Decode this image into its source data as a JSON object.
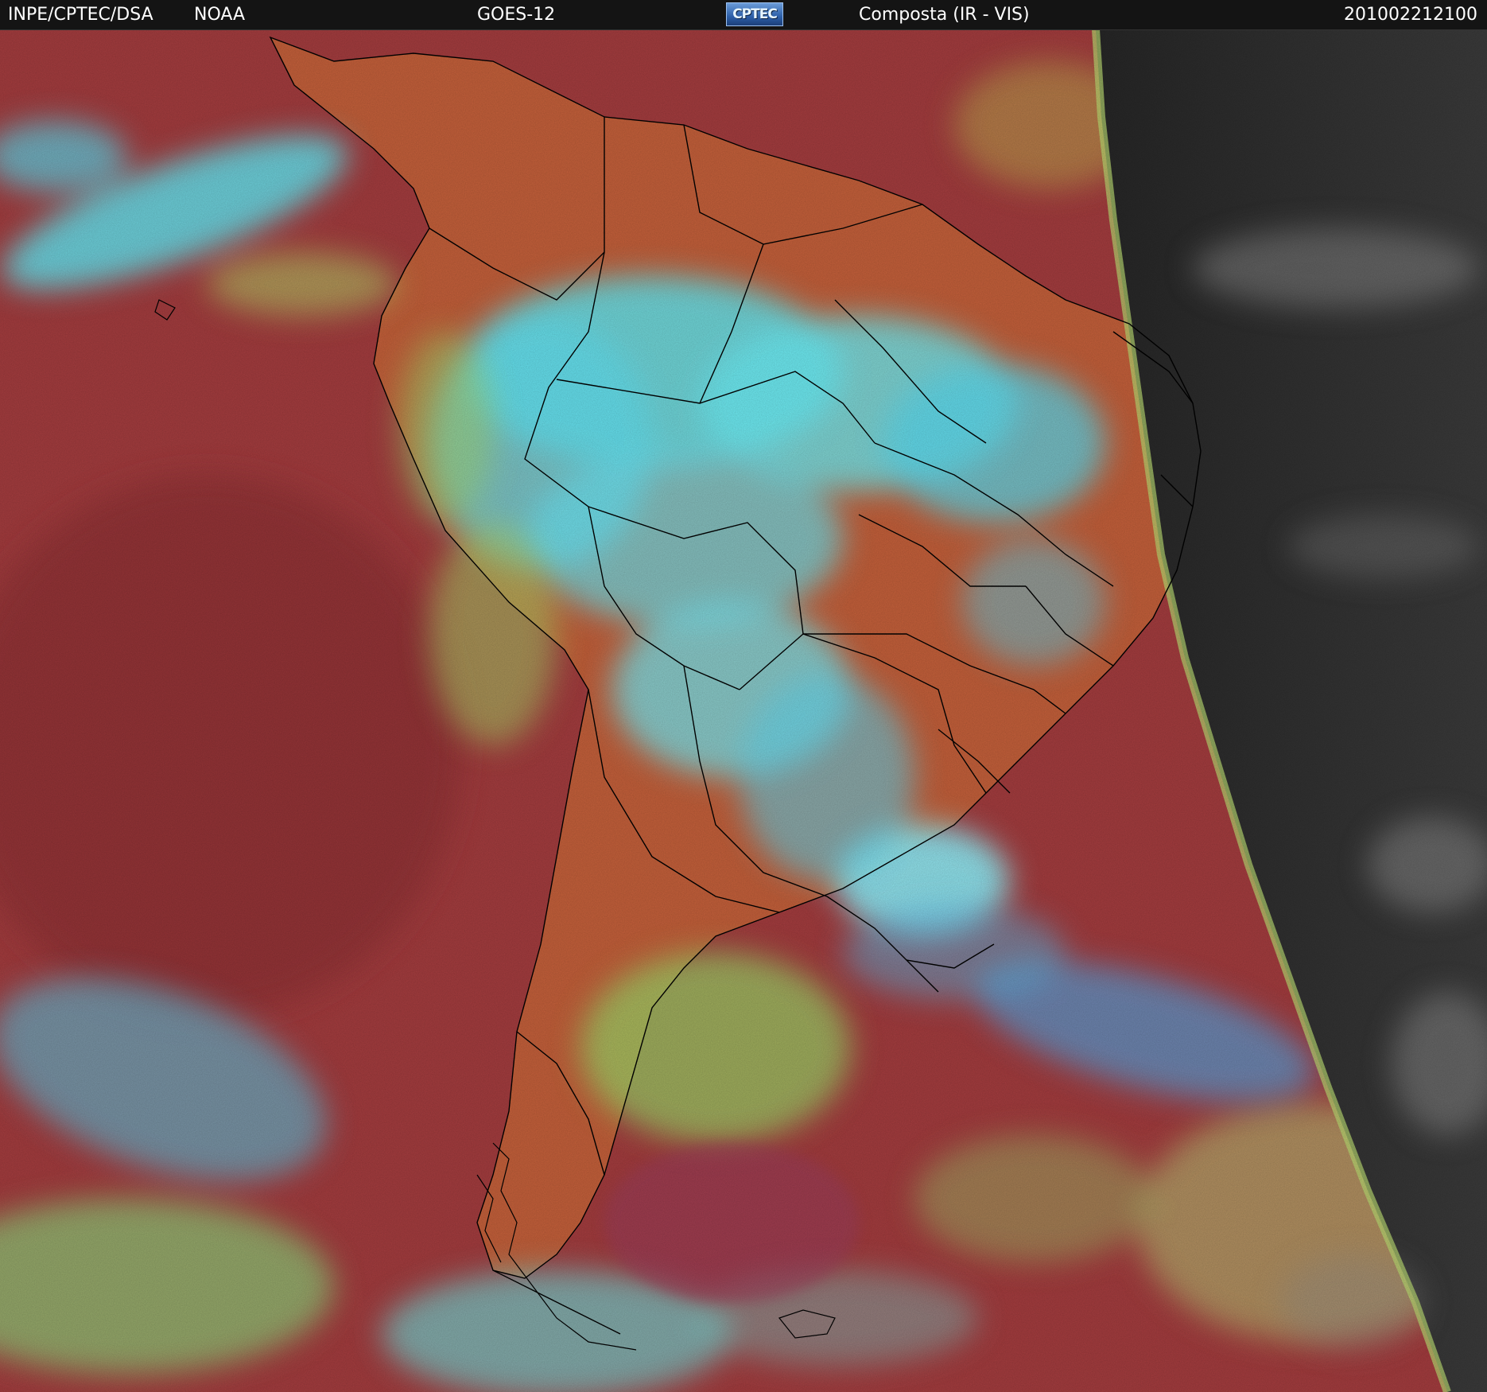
{
  "header": {
    "source": "INPE/CPTEC/DSA",
    "agency": "NOAA",
    "satellite": "GOES-12",
    "logo": "CPTEC",
    "product": "Composta (IR - VIS)",
    "timestamp": "201002212100"
  },
  "colors": {
    "header_bg": "#141414",
    "header_text": "#ffffff",
    "ocean_red": "#a83c3c",
    "land_orange": "#c8623a",
    "cloud_cyan": "#5fe8f2",
    "cloud_green": "#9ad46a",
    "night_gray": "#2c2c2c",
    "border_line": "#000000"
  }
}
